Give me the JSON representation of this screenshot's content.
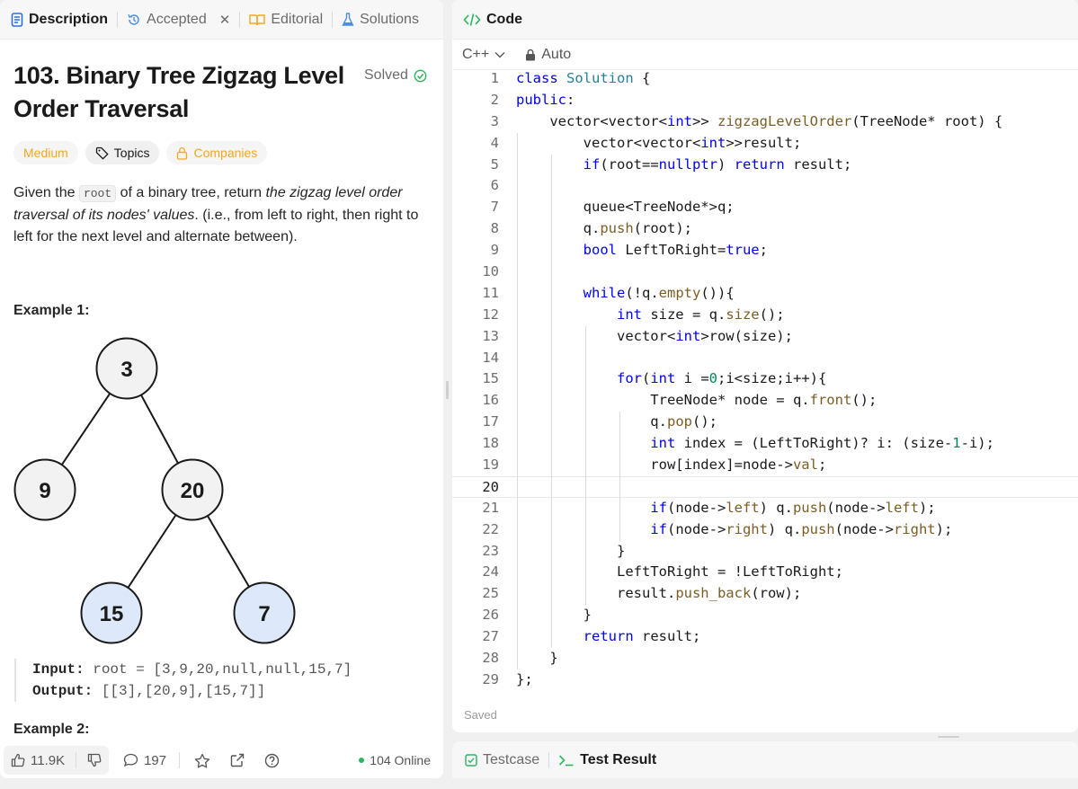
{
  "left_tabs": {
    "description": "Description",
    "accepted": "Accepted",
    "editorial": "Editorial",
    "solutions": "Solutions"
  },
  "problem": {
    "title": "103. Binary Tree Zigzag Level Order Traversal",
    "status": "Solved",
    "difficulty": "Medium",
    "topics_label": "Topics",
    "companies_label": "Companies",
    "desc_p1": "Given the ",
    "desc_code": "root",
    "desc_p2": " of a binary tree, return ",
    "desc_italic": "the zigzag level order traversal of its nodes' values",
    "desc_p3": ". (i.e., from left to right, then right to left for the next level and alternate between)."
  },
  "example1": {
    "heading": "Example 1:",
    "tree_nodes": [
      "3",
      "9",
      "20",
      "15",
      "7"
    ],
    "input_label": "Input:",
    "input_value": " root = [3,9,20,null,null,15,7]",
    "output_label": "Output:",
    "output_value": " [[3],[20,9],[15,7]]"
  },
  "example2": {
    "heading": "Example 2:"
  },
  "footer": {
    "likes": "11.9K",
    "comments": "197",
    "online": "104 Online"
  },
  "editor": {
    "tab_label": "Code",
    "language": "C++",
    "mode": "Auto",
    "saved": "Saved",
    "current_line": 20
  },
  "code_lines": [
    "class Solution {",
    "public:",
    "    vector<vector<int>> zigzagLevelOrder(TreeNode* root) {",
    "        vector<vector<int>>result;",
    "        if(root==nullptr) return result;",
    "",
    "        queue<TreeNode*>q;",
    "        q.push(root);",
    "        bool LeftToRight=true;",
    "",
    "        while(!q.empty()){",
    "            int size = q.size();",
    "            vector<int>row(size);",
    "",
    "            for(int i =0;i<size;i++){",
    "                TreeNode* node = q.front();",
    "                q.pop();",
    "                int index = (LeftToRight)? i: (size-1-i);",
    "                row[index]=node->val;",
    "",
    "                if(node->left) q.push(node->left);",
    "                if(node->right) q.push(node->right);",
    "            }",
    "            LeftToRight = !LeftToRight;",
    "            result.push_back(row);",
    "        }",
    "        return result;",
    "    }",
    "};"
  ],
  "bottom_tabs": {
    "testcase": "Testcase",
    "test_result": "Test Result"
  },
  "colors": {
    "accent_green": "#2db55d",
    "medium_orange": "#f5a623",
    "node_fill": "#f2f2f2",
    "leaf_fill": "#dde9fb",
    "keyword": "#0000ff",
    "type": "#267f99",
    "function": "#795e26",
    "number": "#098658"
  }
}
